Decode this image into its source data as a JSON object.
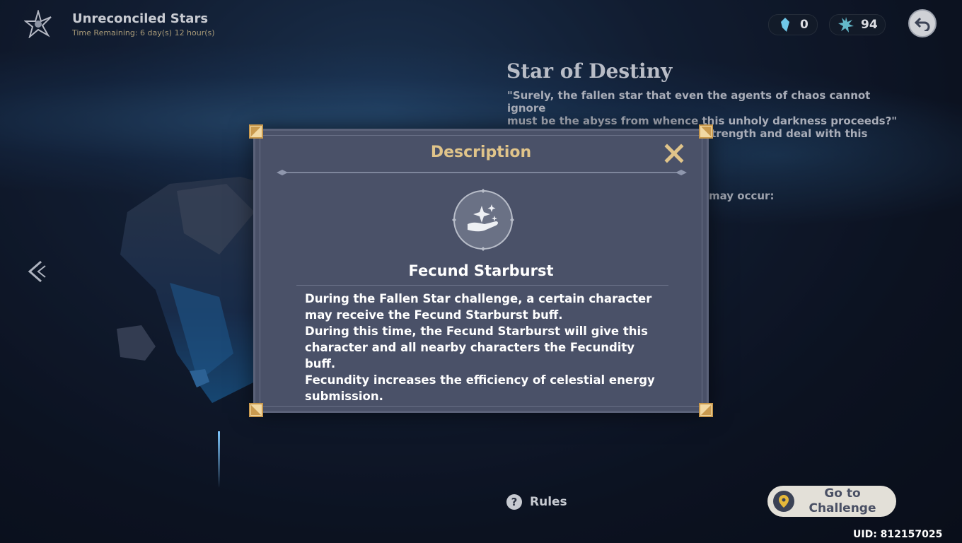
{
  "header": {
    "event_title": "Unreconciled Stars",
    "time_remaining": "Time Remaining: 6 day(s) 12 hour(s)"
  },
  "currencies": [
    {
      "icon": "crystal-shard-icon",
      "value": "0"
    },
    {
      "icon": "star-burst-icon",
      "value": "94"
    }
  ],
  "info_panel": {
    "title": "Star of Destiny",
    "quote_line_1": "\"Surely, the fallen star that even the agents of chaos cannot ignore",
    "quote_line_2": "must be the abyss from whence this unholy darkness proceeds?\"",
    "quote_line_3": "\"Alright, let's pool our collective strength and deal with this latest",
    "partial_text": "may occur:"
  },
  "dialog": {
    "title": "Description",
    "buff_name": "Fecund Starburst",
    "description_lines": [
      "During the Fallen Star challenge, a certain character may receive the Fecund Starburst buff.",
      "During this time, the Fecund Starburst will give this character and all nearby characters the Fecundity buff.",
      "Fecundity increases the efficiency of celestial energy submission."
    ]
  },
  "footer": {
    "rules_label": "Rules",
    "go_line_1": "Go to",
    "go_line_2": "Challenge",
    "uid": "UID: 812157025"
  },
  "colors": {
    "dialog_bg": "#4a5168",
    "title_gold": "#e0c48a",
    "accent_gold": "#d8b26a"
  }
}
